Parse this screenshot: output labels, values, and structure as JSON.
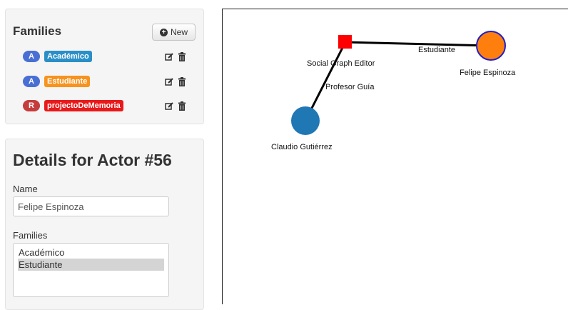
{
  "families_panel": {
    "title": "Families",
    "new_button": {
      "label": "New",
      "icon": "plus-circle-icon"
    },
    "items": [
      {
        "badge": "A",
        "badge_color": "#4a6fd4",
        "label": "Académico",
        "label_color": "#2a8fc7",
        "edit_icon": "edit-icon",
        "delete_icon": "trash-icon"
      },
      {
        "badge": "A",
        "badge_color": "#4a6fd4",
        "label": "Estudiante",
        "label_color": "#f7931e",
        "edit_icon": "edit-icon",
        "delete_icon": "trash-icon"
      },
      {
        "badge": "R",
        "badge_color": "#c63b3b",
        "label": "projectoDeMemoria",
        "label_color": "#e8191a",
        "edit_icon": "edit-icon",
        "delete_icon": "trash-icon"
      }
    ]
  },
  "details_panel": {
    "title": "Details for Actor #56",
    "name_label": "Name",
    "name_value": "Felipe Espinoza",
    "families_label": "Families",
    "families_options": [
      {
        "label": "Académico",
        "selected": false
      },
      {
        "label": "Estudiante",
        "selected": true
      }
    ]
  },
  "graph": {
    "nodes": [
      {
        "id": "n1",
        "label": "Social Graph Editor",
        "shape": "square",
        "color": "#ff0000"
      },
      {
        "id": "n2",
        "label": "Felipe Espinoza",
        "shape": "circle",
        "color": "#ff7f0e",
        "stroke": "#1f1fd0"
      },
      {
        "id": "n3",
        "label": "Claudio Gutiérrez",
        "shape": "circle",
        "color": "#1f77b4"
      }
    ],
    "edges": [
      {
        "from": "n1",
        "to": "n2",
        "label": "Estudiante"
      },
      {
        "from": "n1",
        "to": "n3",
        "label": "Profesor Guía"
      }
    ]
  }
}
